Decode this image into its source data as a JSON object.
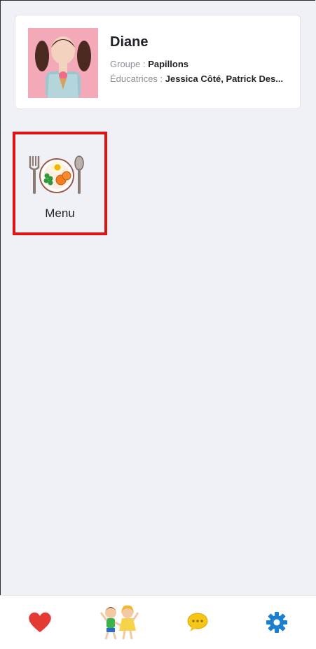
{
  "profile": {
    "name": "Diane",
    "group_label": "Groupe : ",
    "group_value": "Papillons",
    "educators_label": "Éducatrices : ",
    "educators_value": "Jessica Côté, Patrick Des..."
  },
  "tiles": [
    {
      "label": "Menu",
      "icon": "meal-plate-icon"
    }
  ],
  "bottom_nav": [
    {
      "icon": "heart-icon",
      "color": "#e53935"
    },
    {
      "icon": "kids-icon"
    },
    {
      "icon": "chat-bubble-icon",
      "color": "#f5c518"
    },
    {
      "icon": "gear-icon",
      "color": "#1a7fd1"
    }
  ],
  "colors": {
    "highlight": "#dc1414",
    "background": "#f0f1f6"
  }
}
